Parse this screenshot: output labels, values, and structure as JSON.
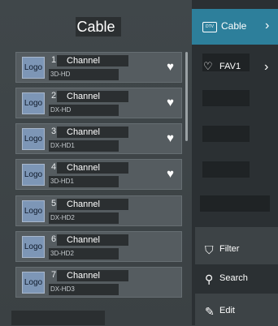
{
  "header": {
    "title": "Cable"
  },
  "channels": [
    {
      "logo": "Logo",
      "number": "1",
      "name": "Channel",
      "sub": "3D-HD",
      "favorite": true
    },
    {
      "logo": "Logo",
      "number": "2",
      "name": "Channel",
      "sub": "DX-HD",
      "favorite": true
    },
    {
      "logo": "Logo",
      "number": "3",
      "name": "Channel",
      "sub": "DX-HD1",
      "favorite": true
    },
    {
      "logo": "Logo",
      "number": "4",
      "name": "Channel",
      "sub": "3D-HD1",
      "favorite": true
    },
    {
      "logo": "Logo",
      "number": "5",
      "name": "Channel",
      "sub": "DX-HD2",
      "favorite": false
    },
    {
      "logo": "Logo",
      "number": "6",
      "name": "Channel",
      "sub": "3D-HD2",
      "favorite": false
    },
    {
      "logo": "Logo",
      "number": "7",
      "name": "Channel",
      "sub": "DX-HD3",
      "favorite": false
    }
  ],
  "sidebar": {
    "categories": [
      {
        "label": "Cable",
        "icon": "tv-icon",
        "icon_text": "DTV",
        "active": true
      },
      {
        "label": "FAV1",
        "icon": "heart-icon",
        "active": false
      }
    ],
    "menu": [
      {
        "label": "Filter",
        "icon": "filter-icon"
      },
      {
        "label": "Search",
        "icon": "search-icon"
      },
      {
        "label": "Edit",
        "icon": "edit-icon"
      }
    ]
  },
  "colors": {
    "accent": "#2d7f9b",
    "logo_bg": "#7d96b6"
  }
}
